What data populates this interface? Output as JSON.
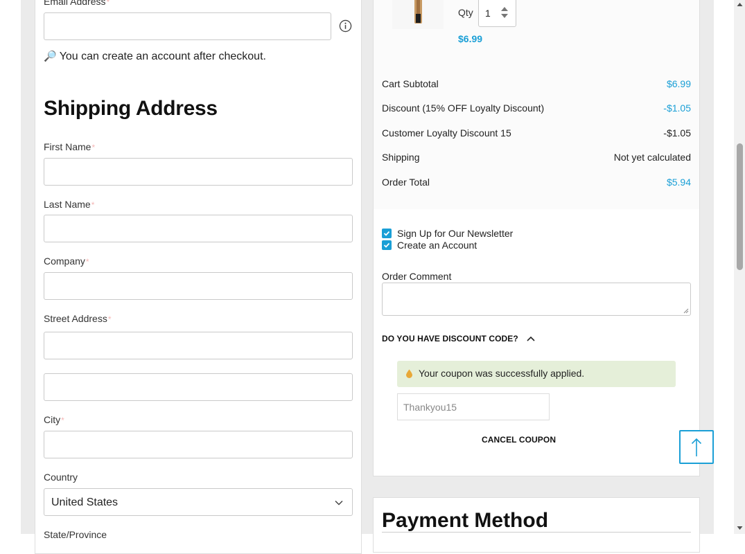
{
  "checkout": {
    "email": {
      "label": "Email Address",
      "required_mark": "*",
      "value": "",
      "info_icon": "info-circle-icon"
    },
    "account_note": {
      "icon": "magnifier-icon",
      "text": "You can create an account after checkout."
    },
    "shipping": {
      "title": "Shipping Address",
      "first_name_label": "First Name",
      "last_name_label": "Last Name",
      "company_label": "Company",
      "street_label": "Street Address",
      "city_label": "City",
      "country_label": "Country",
      "country_value": "United States",
      "state_label": "State/Province",
      "required_mark": "*"
    }
  },
  "cart": {
    "qty_label": "Qty",
    "qty_value": "1",
    "item_price": "$6.99",
    "summary": [
      {
        "label": "Cart Subtotal",
        "value": "$6.99",
        "highlight": true
      },
      {
        "label": "Discount (15% OFF Loyalty Discount)",
        "value": "-$1.05",
        "highlight": true
      },
      {
        "label": "Customer Loyalty Discount 15",
        "value": "-$1.05",
        "highlight": false
      },
      {
        "label": "Shipping",
        "value": "Not yet calculated",
        "highlight": false
      },
      {
        "label": "Order Total",
        "value": "$5.94",
        "highlight": true
      }
    ],
    "newsletter_label": "Sign Up for Our Newsletter",
    "create_account_label": "Create an Account",
    "comment_label": "Order Comment",
    "discount_toggle": "DO YOU HAVE DISCOUNT CODE?",
    "coupon_message": "Your coupon was successfully applied.",
    "coupon_value": "Thankyou15",
    "cancel_coupon": "CANCEL COUPON"
  },
  "payment": {
    "title": "Payment Method"
  },
  "colors": {
    "accent": "#1a9fd6",
    "success_bg": "#e5efd9",
    "page_bg": "#ebebeb"
  }
}
